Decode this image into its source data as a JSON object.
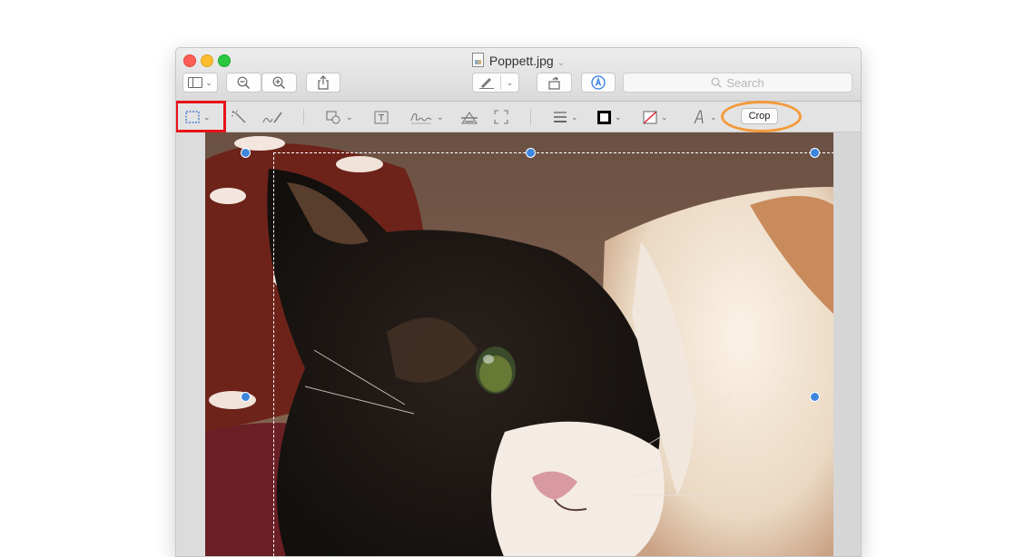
{
  "window": {
    "title": "Poppett.jpg",
    "title_chevron": "⌄"
  },
  "toolbar": {
    "sidebar_icon": "sidebar-icon",
    "zoom_out_icon": "zoom-out-icon",
    "zoom_in_icon": "zoom-in-icon",
    "share_icon": "share-icon",
    "pen_icon": "pen-icon",
    "rotate_icon": "rotate-icon",
    "markup_icon": "markup-icon",
    "search_placeholder": "Search"
  },
  "markup_toolbar": {
    "selection_tool": "rectangular-selection-icon",
    "instant_alpha": "magic-wand-icon",
    "sketch": "sketch-icon",
    "shapes": "shapes-icon",
    "text": "text-box-icon",
    "sign": "signature-icon",
    "adjust_color": "adjust-color-icon",
    "adjust_size": "resize-icon",
    "shape_style": "line-style-icon",
    "border_color": "border-color-icon",
    "fill_color": "fill-color-icon",
    "text_style": "text-style-icon",
    "crop_label": "Crop"
  },
  "annotations": {
    "red_box_color": "#e8121a",
    "orange_ellipse_color": "#f49a3a"
  },
  "colors": {
    "selection_handle": "#3e86de"
  }
}
